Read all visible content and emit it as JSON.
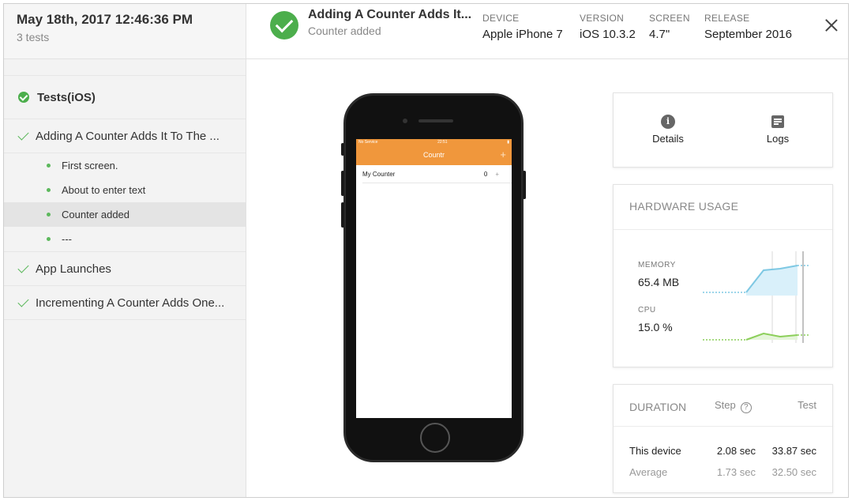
{
  "sidebar": {
    "date": "May 18th, 2017 12:46:36 PM",
    "test_count": "3 tests",
    "suite": "Tests(iOS)",
    "tests": [
      {
        "label": "Adding A Counter Adds It To The ...",
        "steps": [
          "First screen.",
          "About to enter text",
          "Counter added",
          "---"
        ]
      },
      {
        "label": "App Launches"
      },
      {
        "label": "Incrementing A Counter Adds One..."
      }
    ]
  },
  "header": {
    "title": "Adding A Counter Adds It...",
    "subtitle": "Counter added",
    "meta": [
      {
        "key": "DEVICE",
        "value": "Apple iPhone 7"
      },
      {
        "key": "VERSION",
        "value": "iOS 10.3.2"
      },
      {
        "key": "SCREEN",
        "value": "4.7\""
      },
      {
        "key": "RELEASE",
        "value": "September 2016"
      }
    ]
  },
  "phone": {
    "carrier": "No Service",
    "time": "22:51",
    "app_title": "Countr",
    "plus": "+",
    "row_name": "My Counter",
    "row_value": "0",
    "row_plus": "+"
  },
  "actions": {
    "details": "Details",
    "logs": "Logs"
  },
  "hardware": {
    "title": "HARDWARE USAGE",
    "memory_label": "MEMORY",
    "memory_value": "65.4 MB",
    "cpu_label": "CPU",
    "cpu_value": "15.0 %",
    "memory_color": "#7ec8e3",
    "cpu_color": "#8ccf5a"
  },
  "duration": {
    "title": "DURATION",
    "step_label": "Step",
    "test_label": "Test",
    "rows": [
      {
        "label": "This device",
        "step": "2.08 sec",
        "test": "33.87 sec"
      },
      {
        "label": "Average",
        "step": "1.73 sec",
        "test": "32.50 sec"
      }
    ]
  },
  "colors": {
    "success": "#4cae4c",
    "app_accent": "#f0973c"
  }
}
